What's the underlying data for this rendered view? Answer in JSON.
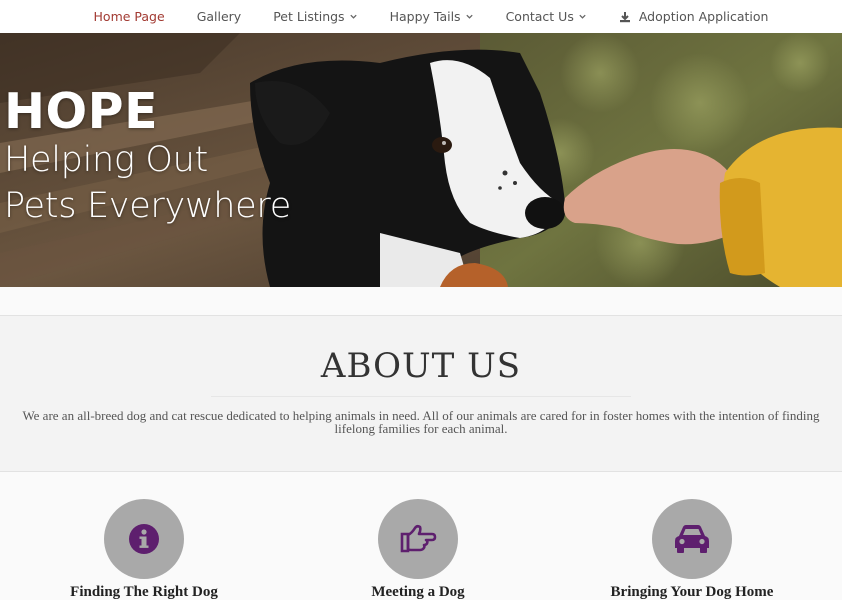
{
  "nav": {
    "items": [
      {
        "label": "Home Page",
        "active": true,
        "dropdown": false
      },
      {
        "label": "Gallery",
        "active": false,
        "dropdown": false
      },
      {
        "label": "Pet Listings",
        "active": false,
        "dropdown": true
      },
      {
        "label": "Happy Tails",
        "active": false,
        "dropdown": true
      },
      {
        "label": "Contact Us",
        "active": false,
        "dropdown": true
      }
    ],
    "adoption": {
      "label": "Adoption Application",
      "icon": "download-icon"
    }
  },
  "hero": {
    "title": "HOPE",
    "line1": "Helping Out",
    "line2": "Pets Everywhere"
  },
  "about": {
    "title": "ABOUT US",
    "text": "We are an all-breed dog and cat rescue dedicated to helping animals in need. All of our animals are cared for in foster homes with the intention of finding lifelong families for each animal."
  },
  "features": [
    {
      "title": "Finding The Right Dog",
      "icon": "info-icon"
    },
    {
      "title": "Meeting a Dog",
      "icon": "pointing-hand-icon"
    },
    {
      "title": "Bringing Your Dog Home",
      "icon": "car-icon"
    }
  ],
  "colors": {
    "nav_active": "#a23a32",
    "icon_purple": "#5e1f6e",
    "circle_gray": "#a9a9a9"
  }
}
